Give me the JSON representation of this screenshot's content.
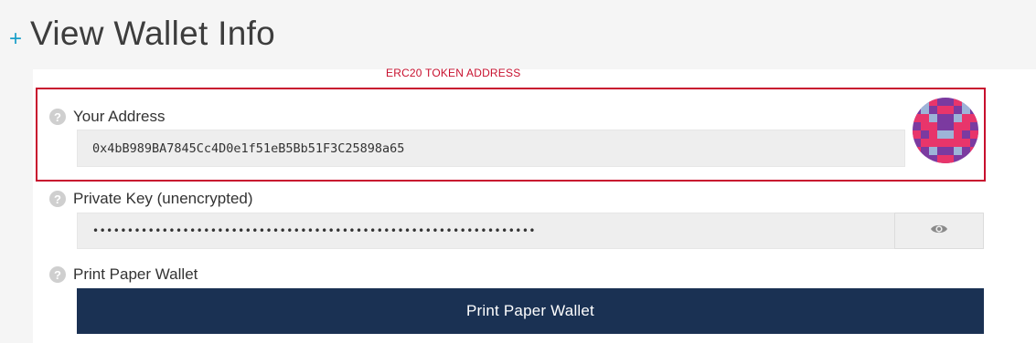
{
  "header": {
    "plus_icon": "+",
    "title": "View Wallet Info"
  },
  "annotation": {
    "label": "ERC20 TOKEN ADDRESS",
    "color": "#c8102e"
  },
  "address_section": {
    "label": "Your Address",
    "help_icon": "question-circle-icon",
    "value": "0x4bB989BA7845Cc4D0e1f51eB5Bb51F3C25898a65"
  },
  "private_key_section": {
    "label": "Private Key (unencrypted)",
    "help_icon": "question-circle-icon",
    "masked_value": "••••••••••••••••••••••••••••••••••••••••••••••••••••••••••••••••",
    "toggle_icon": "eye-icon"
  },
  "paper_wallet_section": {
    "label": "Print Paper Wallet",
    "help_icon": "question-circle-icon",
    "button_label": "Print Paper Wallet"
  },
  "colors": {
    "accent_plus": "#1a9fc9",
    "button_bg": "#1a3153",
    "identicon_bg": "#7b3aa0",
    "identicon_pink": "#e8356b",
    "identicon_light": "#9db4d8"
  }
}
